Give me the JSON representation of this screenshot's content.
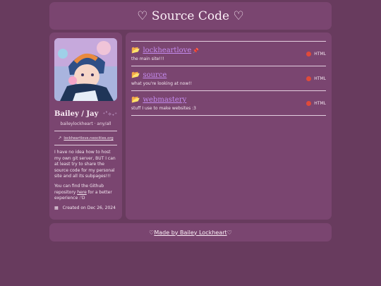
{
  "header": {
    "title": "♡ Source Code ♡"
  },
  "profile": {
    "name": "Bailey / Jay",
    "name_sparkle": "⁺˚✧₊⁺",
    "handle": "baileylockheart · any/all",
    "site": "lockheartlove.neocities.org",
    "bio_p1": "I have no idea how to host my own git server, BUT I can at least try to share the source code for my personal site and all its subpages!!!",
    "bio_p2_before": "You can find the Github repository ",
    "bio_p2_link": "here",
    "bio_p2_after": " for a better experience :'D",
    "created": "Created on Dec 26, 2024"
  },
  "repos": [
    {
      "name": "lockheartlove",
      "pin": "📌",
      "desc": "the main site!!!",
      "lang": "HTML"
    },
    {
      "name": "source",
      "pin": "",
      "desc": "what you're looking at now!!",
      "lang": "HTML"
    },
    {
      "name": "webmastery",
      "pin": "",
      "desc": "stuff I use to make websites :3",
      "lang": "HTML"
    }
  ],
  "footer": {
    "before": "♡ ",
    "link": "Made by Bailey Lockheart",
    "after": " ♡"
  },
  "icons": {
    "folder": "folder-open-icon",
    "pin": "pushpin-icon",
    "calendar": "calendar-icon",
    "external": "external-link-icon"
  },
  "colors": {
    "background": "#683b5e",
    "panel": "#7a4570",
    "link": "#c68cf0",
    "html_dot": "#e04a3a"
  }
}
